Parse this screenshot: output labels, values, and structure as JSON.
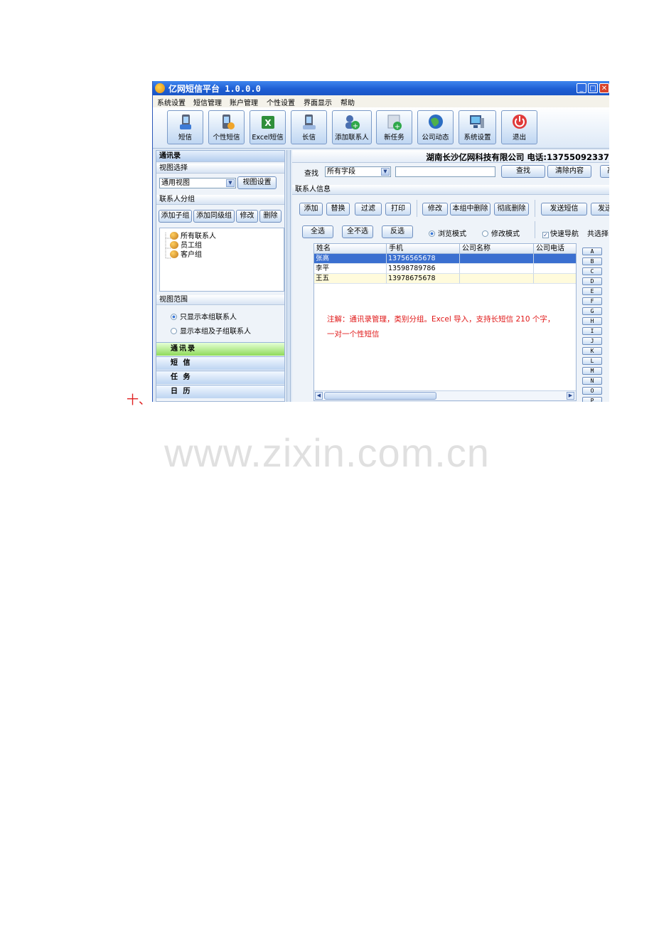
{
  "doc": {
    "prefix": "十、",
    "watermark": "www.zixin.com.cn"
  },
  "window": {
    "title": "亿网短信平台 1.0.0.0",
    "controls": {
      "minimize": "_",
      "maximize": "□",
      "close": "✕"
    }
  },
  "menu": [
    "系统设置",
    "短信管理",
    "账户管理",
    "个性设置",
    "界面显示",
    "帮助"
  ],
  "toolbar": [
    {
      "label": "短信",
      "icon": "phone-icon"
    },
    {
      "label": "个性短信",
      "icon": "user-phone-icon"
    },
    {
      "label": "Excel短信",
      "icon": "excel-icon"
    },
    {
      "label": "长信",
      "icon": "long-message-icon"
    },
    {
      "label": "添加联系人",
      "icon": "add-contact-icon"
    },
    {
      "label": "新任务",
      "icon": "new-task-icon"
    },
    {
      "label": "公司动态",
      "icon": "globe-icon"
    },
    {
      "label": "系统设置",
      "icon": "computer-settings-icon"
    },
    {
      "label": "退出",
      "icon": "power-icon"
    }
  ],
  "sidebar": {
    "header": "通讯录",
    "view_select": {
      "title": "视图选择",
      "value": "通用视图",
      "button": "视图设置"
    },
    "groups": {
      "title": "联系人分组",
      "buttons": [
        "添加子组",
        "添加同级组",
        "修改",
        "删除"
      ],
      "tree": [
        "所有联系人",
        "员工组",
        "客户组"
      ]
    },
    "scope": {
      "title": "视图范围",
      "options": [
        {
          "label": "只显示本组联系人",
          "selected": true
        },
        {
          "label": "显示本组及子组联系人",
          "selected": false
        }
      ]
    },
    "nav": [
      {
        "label": "通讯录",
        "active": true
      },
      {
        "label": "短 信",
        "active": false
      },
      {
        "label": "任 务",
        "active": false
      },
      {
        "label": "日 历",
        "active": false
      }
    ]
  },
  "main": {
    "company": "湖南长沙亿网科技有限公司 电话:13755092337",
    "search": {
      "label": "查找",
      "field": "所有字段",
      "value": "",
      "find_button": "查找",
      "clear_button": "清除内容",
      "more_button": "高"
    },
    "info_title": "联系人信息",
    "actions1": [
      "添加",
      "替换",
      "过滤",
      "打印"
    ],
    "actions2": [
      "修改",
      "本组中删除",
      "彻底删除"
    ],
    "actions3": [
      "发送短信",
      "发送"
    ],
    "select_buttons": [
      "全选",
      "全不选",
      "反选"
    ],
    "modes": [
      {
        "label": "浏览模式",
        "selected": true
      },
      {
        "label": "修改模式",
        "selected": false
      }
    ],
    "quick_nav": {
      "label": "快速导航",
      "checked": true
    },
    "count_label": "共选择",
    "table": {
      "columns": [
        "姓名",
        "手机",
        "公司名称",
        "公司电话"
      ],
      "rows": [
        {
          "name": "张高",
          "phone": "13756565678",
          "company": "",
          "tel": "",
          "selected": true
        },
        {
          "name": "李平",
          "phone": "13598789786",
          "company": "",
          "tel": "",
          "selected": false
        },
        {
          "name": "王五",
          "phone": "13978675678",
          "company": "",
          "tel": "",
          "selected": false
        }
      ]
    },
    "note_line1": "注解：通讯录管理，类别分组。Excel 导入，支持长短信 210 个字，",
    "note_line2": "一对一个性短信",
    "alphabet": [
      "A",
      "B",
      "C",
      "D",
      "E",
      "F",
      "G",
      "H",
      "I",
      "J",
      "K",
      "L",
      "M",
      "N",
      "O",
      "P"
    ]
  },
  "colors": {
    "titlebar": "#1e5fd4",
    "selection": "#3a6fd0",
    "note": "#e01818",
    "nav_active": "#8fda5a"
  }
}
